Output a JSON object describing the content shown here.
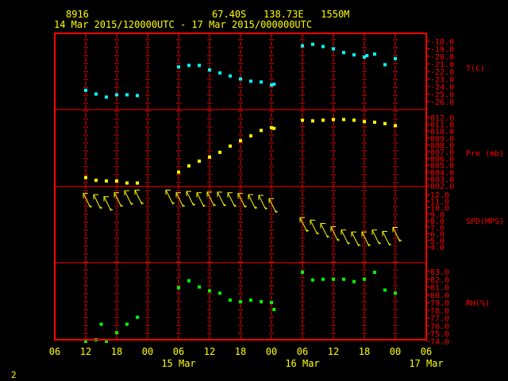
{
  "header": {
    "station": "8916",
    "location": "67.40S   138.73E   1550M",
    "period": "14 Mar 2015/120000UTC - 17 Mar 2015/000000UTC"
  },
  "footer": {
    "page": "2"
  },
  "colors": {
    "frame": "#ff0000",
    "axis_text": "#ffff00",
    "right_labels": "#ff0000",
    "temperature": "#00ffff",
    "pressure": "#ffff00",
    "wind": "#ffff00",
    "humidity": "#00ff00"
  },
  "chart_data": {
    "type": "scatter",
    "x_axis": {
      "tick_labels": [
        "06",
        "12",
        "18",
        "00",
        "06",
        "12",
        "18",
        "00",
        "06",
        "12",
        "18",
        "00",
        "06"
      ],
      "day_labels": [
        {
          "label": "15 Mar",
          "at_hour": 30
        },
        {
          "label": "16 Mar",
          "at_hour": 54
        },
        {
          "label": "17 Mar",
          "at_hour": 78
        }
      ],
      "range_hours_from_14Mar00UTC": [
        6,
        78
      ]
    },
    "panels": [
      {
        "name": "T(C)",
        "ylim": [
          -26,
          -18
        ],
        "ticks": [
          "-18.0",
          "-19.0",
          "-20.0",
          "-21.0",
          "-22.0",
          "-23.0",
          "-24.0",
          "-25.0",
          "-26.0"
        ],
        "label_value": -21.5,
        "x_hours": [
          12,
          14,
          16,
          18,
          20,
          22,
          30,
          32,
          34,
          36,
          38,
          40,
          42,
          44,
          46,
          48,
          48.5,
          54,
          56,
          58,
          60,
          62,
          64,
          66,
          66.5,
          68,
          70,
          72
        ],
        "y": [
          -24.5,
          -25.0,
          -25.4,
          -25.1,
          -25.1,
          -25.2,
          -21.4,
          -21.2,
          -21.2,
          -21.8,
          -22.2,
          -22.6,
          -23.0,
          -23.3,
          -23.4,
          -23.8,
          -23.7,
          -18.6,
          -18.4,
          -18.7,
          -19.0,
          -19.5,
          -19.8,
          -20.1,
          -19.9,
          -19.7,
          -21.1,
          -20.3
        ]
      },
      {
        "name": "Pre (mb)",
        "ylim": [
          802,
          812
        ],
        "ticks": [
          "812.0",
          "811.0",
          "810.0",
          "809.0",
          "808.0",
          "807.0",
          "806.0",
          "805.0",
          "804.0",
          "803.0",
          "802.0"
        ],
        "label_value": 806.8,
        "x_hours": [
          12,
          14,
          16,
          18,
          20,
          22,
          30,
          32,
          34,
          36,
          38,
          40,
          42,
          44,
          46,
          48,
          48.5,
          54,
          56,
          58,
          60,
          62,
          64,
          66,
          68,
          70,
          72
        ],
        "y": [
          803.2,
          802.8,
          802.7,
          802.7,
          802.4,
          802.4,
          804.0,
          804.9,
          805.6,
          806.2,
          806.9,
          807.8,
          808.6,
          809.3,
          810.1,
          810.5,
          810.4,
          811.6,
          811.5,
          811.6,
          811.7,
          811.7,
          811.6,
          811.4,
          811.3,
          811.1,
          810.8
        ]
      },
      {
        "name": "SPD(MPS)",
        "ylim": [
          4,
          13
        ],
        "ticks": [
          "12.0",
          "11.0",
          "10.0",
          "9.0",
          "8.0",
          "7.0",
          "6.0",
          "5.0",
          "4.0"
        ],
        "label_value": 8.0,
        "x_hours": [
          12,
          14,
          16,
          18,
          20,
          22,
          28,
          30,
          32,
          34,
          36,
          38,
          40,
          42,
          44,
          46,
          48,
          54,
          56,
          58,
          60,
          62,
          64,
          66,
          68,
          70,
          72
        ],
        "speed": [
          11.2,
          11.0,
          10.7,
          11.3,
          11.6,
          11.7,
          11.7,
          11.3,
          11.5,
          11.3,
          11.4,
          11.4,
          11.3,
          11.2,
          11.0,
          10.9,
          10.4,
          7.5,
          7.1,
          6.6,
          6.1,
          5.6,
          5.3,
          5.3,
          5.6,
          5.4,
          6.0
        ]
      },
      {
        "name": "RH(%)",
        "ylim": [
          74,
          84
        ],
        "ticks": [
          "83.0",
          "82.0",
          "81.0",
          "80.0",
          "79.0",
          "78.0",
          "77.0",
          "76.0",
          "75.0",
          "74.0"
        ],
        "label_value": 79.0,
        "x_hours": [
          12,
          14,
          15,
          16,
          18,
          20,
          22,
          30,
          32,
          34,
          36,
          38,
          40,
          42,
          44,
          46,
          48,
          48.5,
          54,
          56,
          58,
          60,
          62,
          64,
          66,
          68,
          70,
          72
        ],
        "y": [
          74.0,
          74.2,
          76.2,
          74.0,
          75.1,
          76.2,
          77.1,
          80.9,
          81.8,
          81.0,
          80.5,
          80.2,
          79.3,
          79.1,
          79.3,
          79.1,
          79.0,
          78.1,
          82.9,
          81.9,
          82.0,
          82.0,
          82.0,
          81.7,
          82.0,
          82.9,
          80.6,
          80.2
        ]
      }
    ]
  }
}
